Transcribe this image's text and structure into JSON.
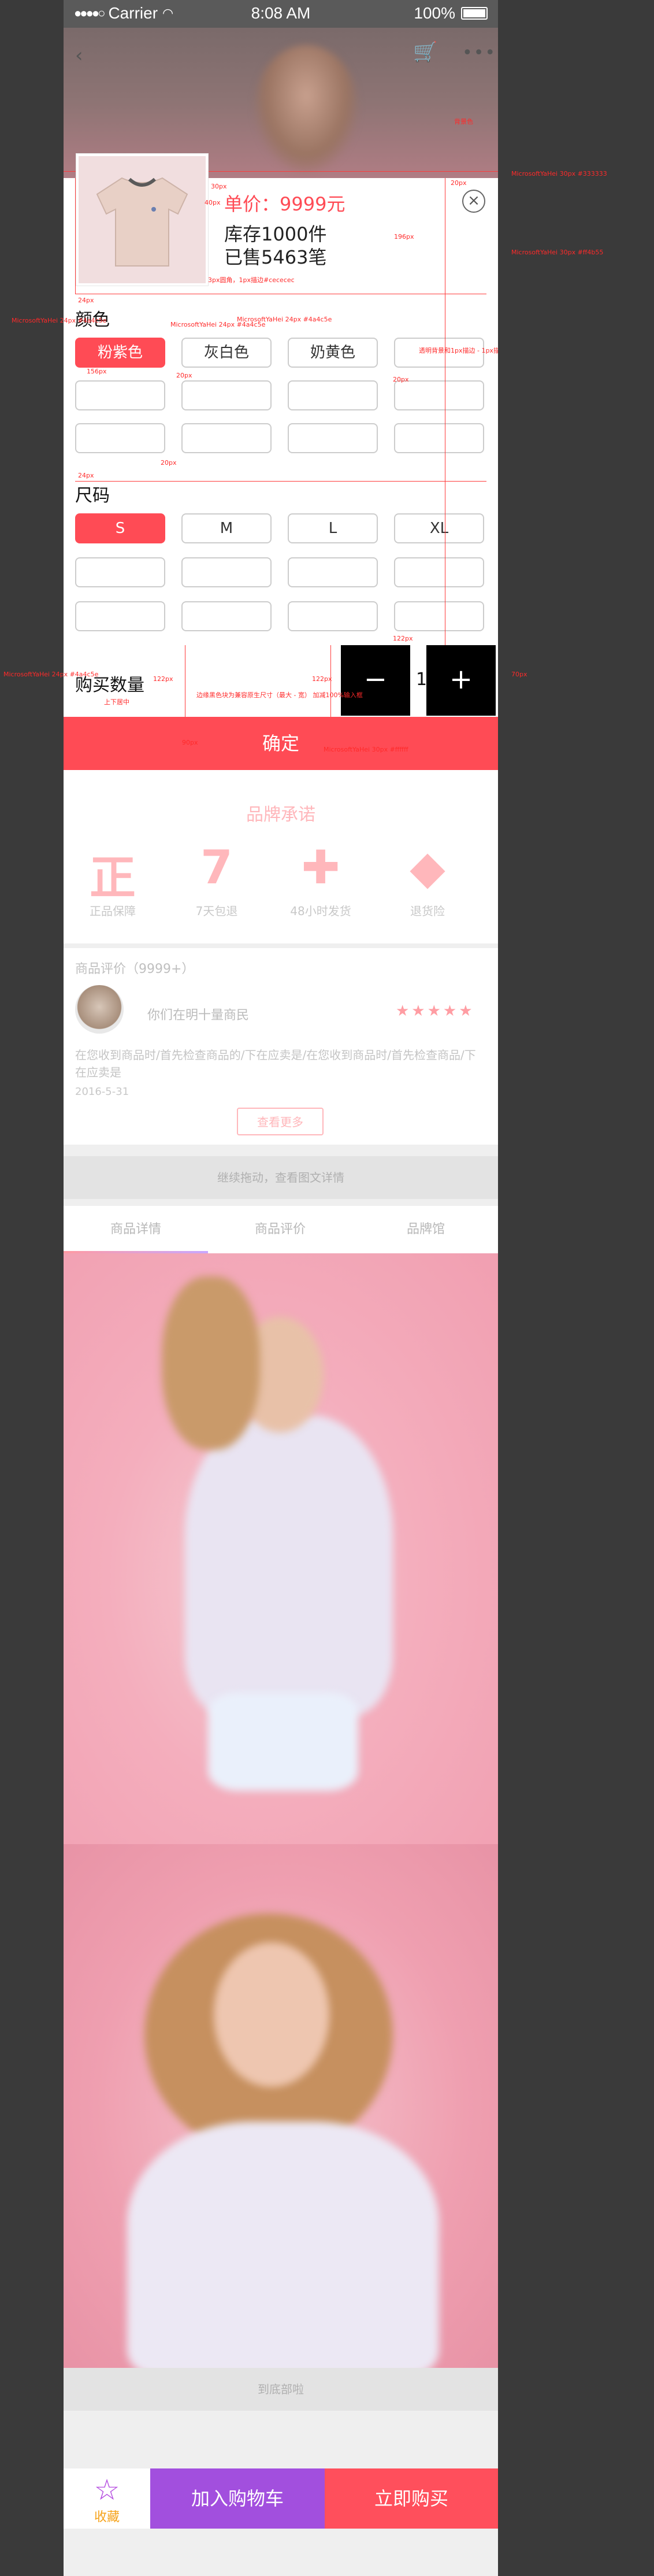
{
  "status_bar": {
    "carrier": "Carrier",
    "time": "8:08 AM",
    "battery": "100%"
  },
  "product_sheet": {
    "price": "单价：9999元",
    "stock": "库存1000件",
    "sold": "已售5463笔",
    "color_title": "颜色",
    "colors": [
      "粉紫色",
      "灰白色",
      "奶黄色"
    ],
    "selected_color": "粉紫色",
    "size_title": "尺码",
    "sizes": [
      "S",
      "M",
      "L",
      "XL"
    ],
    "selected_size": "S",
    "quantity_label": "购买数量",
    "quantity": "1",
    "minus": "−",
    "plus": "+",
    "confirm": "确定"
  },
  "annotations": {
    "price_spec": "MicrosoftYaHei 30px #ff4b55",
    "stock_spec": "MicrosoftYaHei 30px #333333",
    "gap_30px": "30px",
    "gap_20px": "20px",
    "gap_24px": "24px",
    "gap_40px": "40px",
    "gap_156px": "156px",
    "gap_122px": "122px",
    "gap_196px": "196px",
    "gap_70px": "70px",
    "gap_90px": "90px",
    "label_font": "MicrosoftYaHei 24px #4a4c5e",
    "border_note": "3px圆角，1px描边#cececec",
    "unselected_note": "透明背景和1px描边 - 1px描边 #888888",
    "qty_note": "边缘黑色块为兼容原生尺寸（最大 - 宽） 加减100%输入框",
    "center_note": "上下居中",
    "confirm_font": "MicrosoftYaHei 30px #ffffff",
    "bg_note": "背景色"
  },
  "brand": {
    "title": "品牌承诺",
    "items": [
      {
        "icon": "正",
        "label": "正品保障"
      },
      {
        "icon": "7",
        "label": "7天包退"
      },
      {
        "icon": "✚",
        "label": "48小时发货"
      },
      {
        "icon": "◆",
        "label": "退货险"
      }
    ]
  },
  "review": {
    "title": "商品评价（9999+）",
    "name": "你们在明十量商民",
    "stars": "★★★★★",
    "text": "在您收到商品时/首先检查商品的/下在应卖是/在您收到商品时/首先检查商品/下在应卖是",
    "date": "2016-5-31",
    "more": "查看更多"
  },
  "continue_hint": "继续拖动，查看图文详情",
  "tabs": [
    "商品详情",
    "商品评价",
    "品牌馆"
  ],
  "end_hint": "到底部啦",
  "bottom_bar": {
    "favorite": "收藏",
    "add_to_cart": "加入购物车",
    "buy_now": "立即购买"
  },
  "colors": {
    "accent_red": "#ff4b55",
    "purple": "#a24fde",
    "annotation": "#ff2a2a"
  }
}
